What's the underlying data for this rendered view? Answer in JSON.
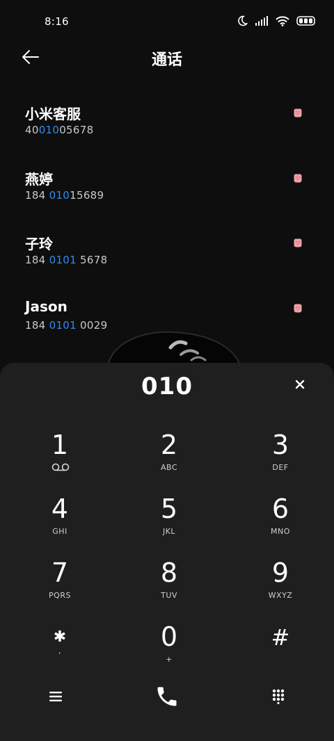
{
  "status_bar": {
    "time": "8:16",
    "icons": [
      "moon-icon",
      "signal-icon",
      "wifi-icon",
      "battery-icon"
    ]
  },
  "header": {
    "title": "通话",
    "back_icon": "arrow-left-icon"
  },
  "contacts": [
    {
      "name": "小米客服",
      "num_pre": "40",
      "num_hl": "010",
      "num_post": "05678"
    },
    {
      "name": "燕婷",
      "num_pre": "184 ",
      "num_hl": "010",
      "num_post": "15689"
    },
    {
      "name": "子玲",
      "num_pre": "184 ",
      "num_hl": "0101",
      "num_post": " 5678"
    },
    {
      "name": "Jason",
      "num_pre": "184 ",
      "num_hl": "0101",
      "num_post": " 0029"
    }
  ],
  "dialpad": {
    "entered": "010",
    "keys": [
      {
        "digit": "1",
        "sub": ""
      },
      {
        "digit": "2",
        "sub": "ABC"
      },
      {
        "digit": "3",
        "sub": "DEF"
      },
      {
        "digit": "4",
        "sub": "GHI"
      },
      {
        "digit": "5",
        "sub": "JKL"
      },
      {
        "digit": "6",
        "sub": "MNO"
      },
      {
        "digit": "7",
        "sub": "PQRS"
      },
      {
        "digit": "8",
        "sub": "TUV"
      },
      {
        "digit": "9",
        "sub": "WXYZ"
      },
      {
        "digit": "✱",
        "sub": ","
      },
      {
        "digit": "0",
        "sub": "+"
      },
      {
        "digit": "#",
        "sub": ""
      }
    ]
  },
  "colors": {
    "background": "#0e0e0e",
    "dialpad_bg": "#1f1f1f",
    "highlight": "#2f8cf0",
    "sim_icon": "#f0a0a8"
  }
}
